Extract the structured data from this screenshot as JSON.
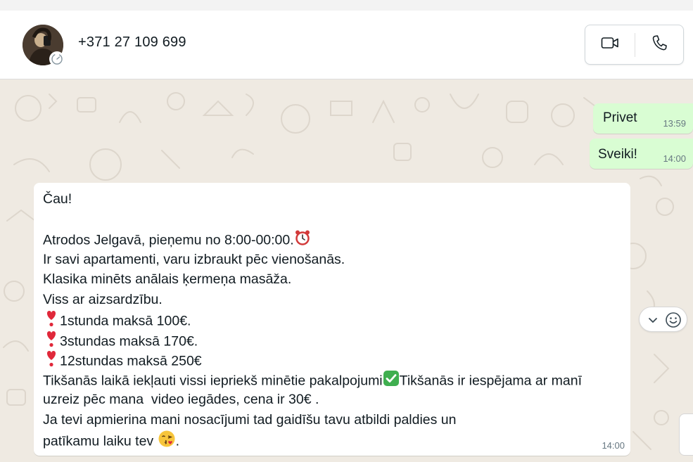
{
  "header": {
    "contact_name": "+371 27 109 699",
    "avatar_icon": "profile-photo",
    "status_icon": "status-ring-icon",
    "video_call_icon": "video-camera-icon",
    "voice_call_icon": "phone-icon"
  },
  "messages": [
    {
      "direction": "outgoing",
      "text": "Privet",
      "time": "13:59"
    },
    {
      "direction": "outgoing",
      "text": "Sveiki!",
      "time": "14:00"
    },
    {
      "direction": "incoming",
      "time": "14:00",
      "lines": [
        {
          "text": "Čau!"
        },
        {
          "text": ""
        },
        {
          "text": "Atrodos Jelgavā, pieņemu no 8:00-00:00.",
          "emoji_after": "alarm-clock-emoji"
        },
        {
          "text": "Ir savi apartamenti, varu izbraukt pēc vienošanās."
        },
        {
          "text": "Klasika minēts anālais ķermeņa masāža."
        },
        {
          "text": "Viss ar aizsardzību."
        },
        {
          "emoji_before": "heart-exclamation-emoji",
          "text": "1stunda maksā 100€."
        },
        {
          "emoji_before": "heart-exclamation-emoji",
          "text": "3stundas maksā 170€."
        },
        {
          "emoji_before": "heart-exclamation-emoji",
          "text": "12stundas maksā 250€"
        },
        {
          "text": "Tikšanās laikā iekļauti vissi iepriekš minētie pakalpojumi",
          "emoji_after": "check-mark-button-emoji",
          "text_after": "Tikšanās ir iespējama ar manī"
        },
        {
          "text": "uzreiz pēc mana  video iegādes, cena ir 30€ ."
        },
        {
          "text": "Ja tevi apmierina mani nosacījumi tad gaidīšu tavu atbildi paldies un"
        },
        {
          "text": "patīkamu laiku tev ",
          "emoji_after": "kissing-face-emoji",
          "text_after": "."
        }
      ]
    }
  ],
  "reaction_controls": {
    "chevron_icon": "chevron-down-icon",
    "react_icon": "smiley-icon"
  },
  "colors": {
    "outgoing_bubble": "#d9fdd3",
    "incoming_bubble": "#ffffff",
    "chat_bg": "#efeae2"
  }
}
